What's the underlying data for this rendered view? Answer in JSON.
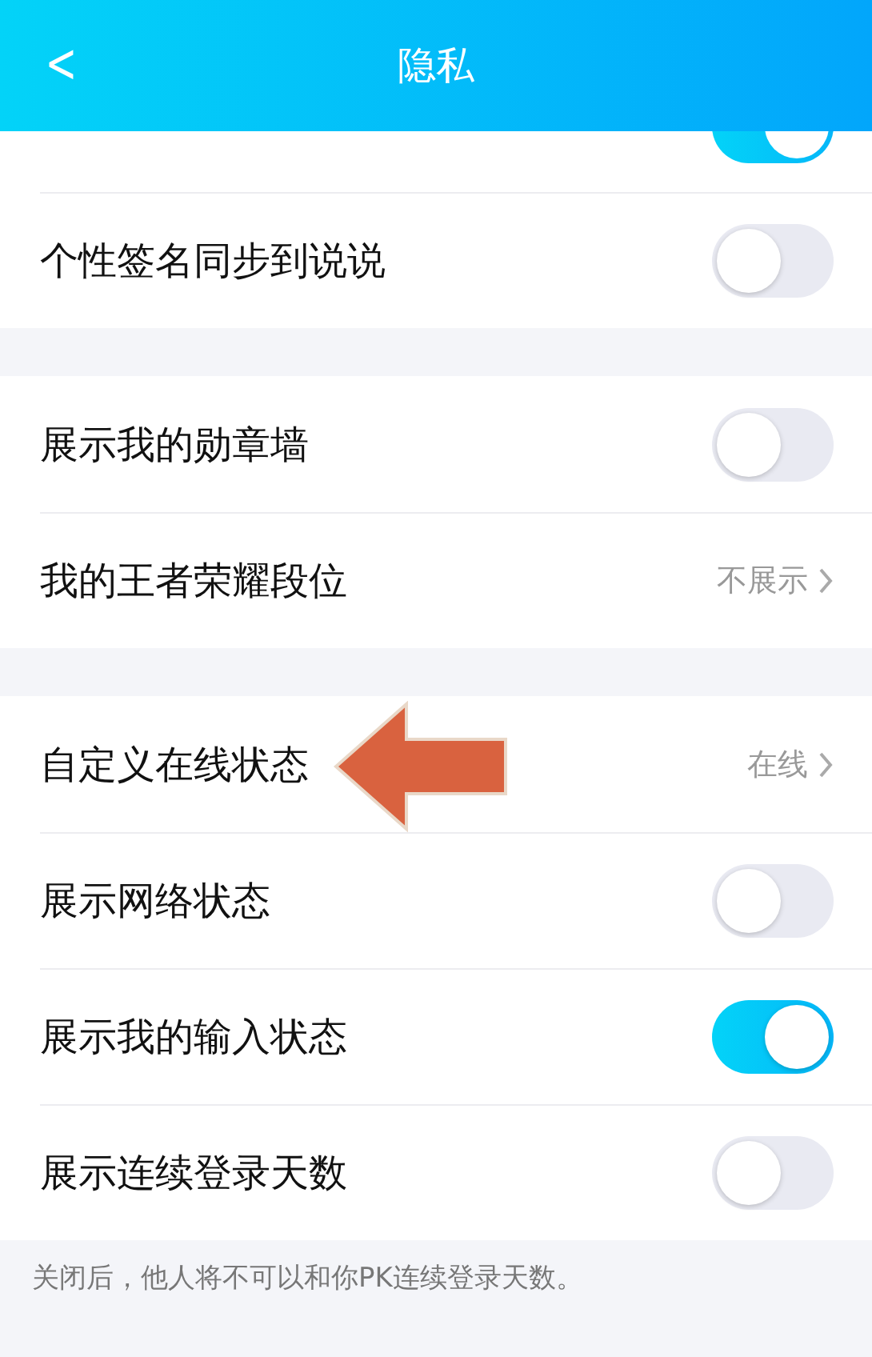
{
  "header": {
    "back": "<",
    "title": "隐私"
  },
  "sections": [
    {
      "rows": [
        {
          "kind": "toggle",
          "on": true,
          "clipped": true
        },
        {
          "kind": "toggle",
          "label": "个性签名同步到说说",
          "on": false
        }
      ]
    },
    {
      "rows": [
        {
          "kind": "toggle",
          "label": "展示我的勋章墙",
          "on": false
        },
        {
          "kind": "link",
          "label": "我的王者荣耀段位",
          "value": "不展示"
        }
      ]
    },
    {
      "rows": [
        {
          "kind": "link",
          "label": "自定义在线状态",
          "value": "在线",
          "pointed": true
        },
        {
          "kind": "toggle",
          "label": "展示网络状态",
          "on": false
        },
        {
          "kind": "toggle",
          "label": "展示我的输入状态",
          "on": true
        },
        {
          "kind": "toggle",
          "label": "展示连续登录天数",
          "on": false
        }
      ]
    }
  ],
  "note": "关闭后，他人将不可以和你PK连续登录天数。"
}
